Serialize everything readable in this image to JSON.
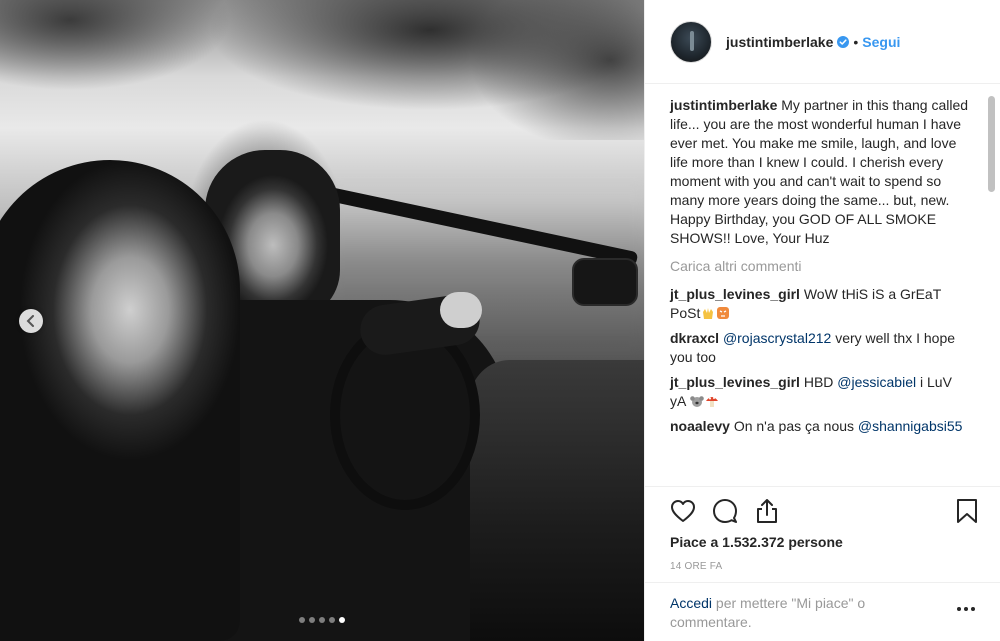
{
  "post": {
    "username": "justintimberlake",
    "separator": "•",
    "follow_label": "Segui",
    "caption_username": "justintimberlake",
    "caption": "My partner in this thang called life... you are the most wonderful human I have ever met. You make me smile, laugh, and love life more than I knew I could. I cherish every moment with you and can't wait to spend so many more years doing the same... but, new. Happy Birthday, you GOD OF ALL SMOKE SHOWS!! Love, Your Huz",
    "load_more_label": "Carica altri commenti",
    "comments": [
      {
        "user": "jt_plus_levines_girl",
        "text": "WoW tHiS iS a GrEaT PoSt"
      },
      {
        "user": "dkraxcl",
        "mention": "@rojascrystal212",
        "text": " very well thx I hope you too"
      },
      {
        "user": "jt_plus_levines_girl",
        "text": "HBD ",
        "mention": "@jessicabiel",
        "text_after": " i LuV yA"
      },
      {
        "user": "noaalevy",
        "text": "On n'a pas ça nous ",
        "mention": "@shannigabsi55"
      }
    ],
    "likes_label": "Piace a 1.532.372 persone",
    "time_label": "14 ORE FA",
    "login_link": "Accedi",
    "login_text": " per mettere \"Mi piace\" o commentare.",
    "carousel": {
      "total": 5,
      "active_index": 4
    }
  },
  "icons": {
    "verified": "verified-badge-icon",
    "like": "heart-icon",
    "comment": "comment-icon",
    "share": "share-icon",
    "save": "bookmark-icon",
    "more": "more-options-icon",
    "prev": "chevron-left-icon"
  },
  "colors": {
    "link_blue": "#3897f0",
    "mention_blue": "#003569",
    "muted": "#999999",
    "text": "#262626",
    "border": "#efefef"
  }
}
